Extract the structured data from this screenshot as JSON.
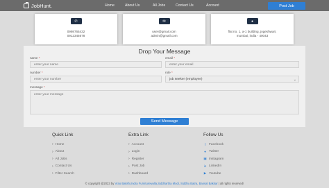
{
  "navbar": {
    "brand": "JobHunt.",
    "links": [
      "Home",
      "About Us",
      "All Jobs",
      "Contact Us",
      "Account"
    ],
    "post_job": "Post Job"
  },
  "contact_cards": [
    {
      "icon": "phone-icon",
      "lines": [
        "0998765432",
        "0912345678"
      ]
    },
    {
      "icon": "envelope-icon",
      "lines": [
        "user@gmail.com",
        "admin@gmail.com"
      ]
    },
    {
      "icon": "map-marker-icon",
      "lines": [
        "flat no. 1, a-1 building, jogeshwari,",
        "mumbai, india - 40043"
      ]
    }
  ],
  "form": {
    "title": "Drop Your Message",
    "name_label": "name",
    "name_placeholder": "enter your name",
    "email_label": "email",
    "email_placeholder": "enter your email",
    "number_label": "number",
    "number_placeholder": "enter your number",
    "role_label": "role",
    "role_value": "job seeker (employee)",
    "message_label": "message",
    "message_placeholder": "enter your message",
    "required_mark": "*",
    "send_label": "Send Message"
  },
  "footer": {
    "quick_link": {
      "title": "Quick Link",
      "items": [
        "Home",
        "About",
        "All Jobs",
        "Contact Us",
        "Filter Search"
      ]
    },
    "extra_link": {
      "title": "Extra Link",
      "items": [
        "Account",
        "Login",
        "Register",
        "Post Job",
        "Dashboard"
      ]
    },
    "follow_us": {
      "title": "Follow Us",
      "items": [
        {
          "icon": "facebook-icon",
          "label": "Facebook"
        },
        {
          "icon": "twitter-icon",
          "label": "Twitter"
        },
        {
          "icon": "instagram-icon",
          "label": "Instagram"
        },
        {
          "icon": "linkedin-icon",
          "label": "LinkedIn"
        },
        {
          "icon": "youtube-icon",
          "label": "Youtube"
        }
      ]
    },
    "copyright_prefix": "© copyright @2023 by",
    "copyright_names": "Vrao Bakshi,Indra Furniturewalla,Siddhartha Modi, Siddhu Batra, Bansal Bakkar",
    "copyright_suffix": "| all rights reserved!"
  }
}
